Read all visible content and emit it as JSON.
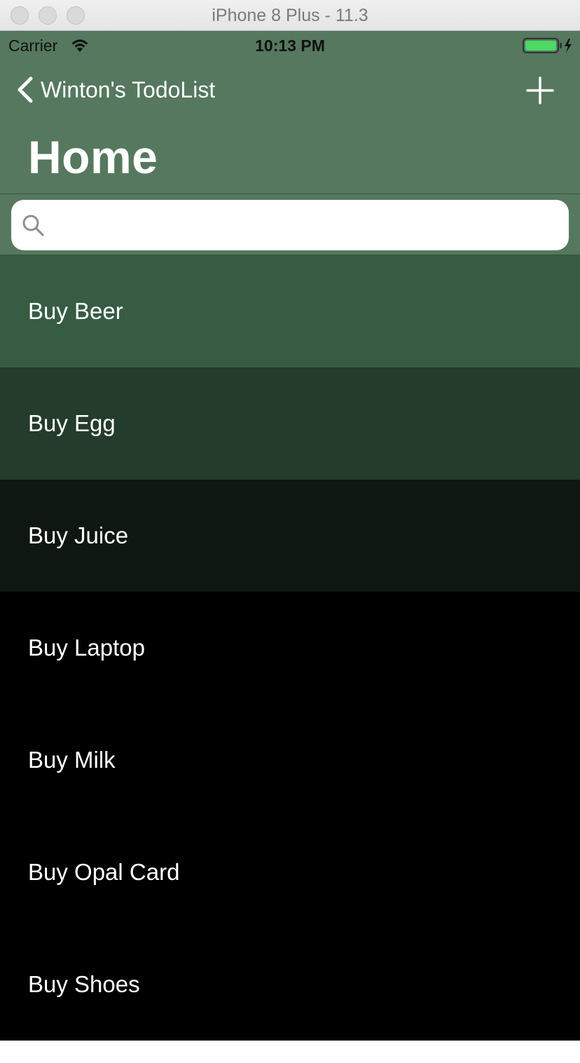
{
  "window": {
    "title": "iPhone 8 Plus - 11.3"
  },
  "status_bar": {
    "carrier": "Carrier",
    "time": "10:13 PM"
  },
  "nav": {
    "back_label": "Winton's TodoList",
    "title": "Home",
    "add_icon": "plus-icon",
    "back_icon": "chevron-left-icon"
  },
  "search": {
    "value": "",
    "placeholder": ""
  },
  "items": [
    {
      "label": "Buy Beer",
      "color": "#365c44"
    },
    {
      "label": "Buy Egg",
      "color": "#233c2c"
    },
    {
      "label": "Buy Juice",
      "color": "#0f1712"
    },
    {
      "label": "Buy Laptop",
      "color": "#000000"
    },
    {
      "label": "Buy Milk",
      "color": "#000000"
    },
    {
      "label": "Buy Opal Card",
      "color": "#000000"
    },
    {
      "label": "Buy Shoes",
      "color": "#000000"
    }
  ],
  "colors": {
    "nav_bar": "#55785e",
    "battery_fill": "#4cd964"
  }
}
